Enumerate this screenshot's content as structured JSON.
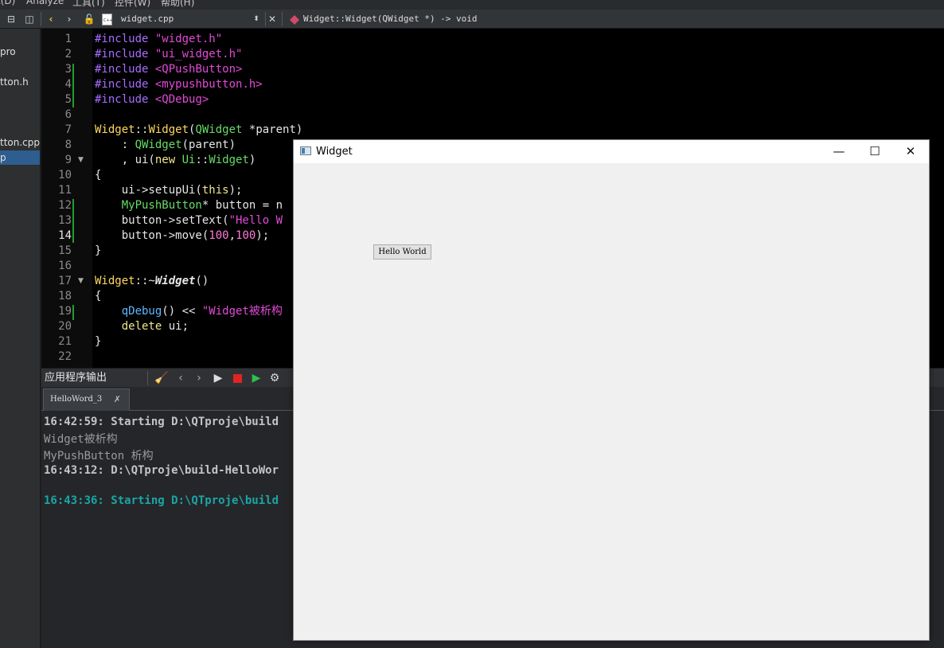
{
  "menu": {
    "items": [
      "t(D)",
      "Analyze",
      "工具(T)",
      "控件(W)",
      "帮助(H)"
    ]
  },
  "toolbar": {
    "split_icon": "split-icon",
    "back_icon": "chevron-left-icon",
    "forward_icon": "chevron-right-icon",
    "lock_icon": "lock-icon",
    "file_icon": "cpp-file-icon",
    "file_name": "widget.cpp",
    "function_signature": "Widget::Widget(QWidget *) -> void"
  },
  "project": {
    "items": [
      "pro",
      "tton.h",
      "tton.cpp",
      "p"
    ],
    "selected_index": 3
  },
  "editor": {
    "current_line": 14,
    "line_numbers": [
      "1",
      "2",
      "3",
      "4",
      "5",
      "6",
      "7",
      "8",
      "9",
      "10",
      "11",
      "12",
      "13",
      "14",
      "15",
      "16",
      "17",
      "18",
      "19",
      "20",
      "21",
      "22"
    ]
  },
  "output": {
    "pane_title": "应用程序输出",
    "tab_label": "HelloWord_3",
    "lines": [
      "16:42:59: Starting D:\\QTproje\\build",
      "Widget被析构",
      "MyPushButton 析构",
      "16:43:12: D:\\QTproje\\build-HelloWor",
      "16:43:36: Starting D:\\QTproje\\build"
    ]
  },
  "widget_window": {
    "title": "Widget",
    "button_label": "Hello World",
    "minimize": "—",
    "maximize": "☐",
    "close": "✕"
  },
  "colors": {
    "keyword_purple": "#a86cff",
    "string_magenta": "#e24ad6",
    "type_yellow": "#ffd85c",
    "class_green": "#66dd66",
    "output_teal": "#1aa6a6",
    "selection_blue": "#2e5d8f"
  }
}
